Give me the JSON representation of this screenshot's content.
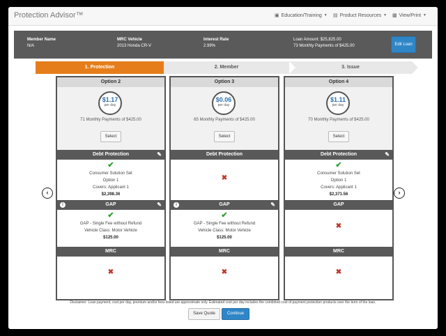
{
  "app": {
    "title": "Protection Advisor™"
  },
  "nav": {
    "education": {
      "icon": "briefcase-icon",
      "label": "Education/Training"
    },
    "resources": {
      "icon": "document-icon",
      "label": "Product Resources"
    },
    "view": {
      "icon": "printer-icon",
      "label": "View/Print"
    }
  },
  "loan": {
    "member_label": "Member Name",
    "member_value": "N/A",
    "vehicle_label": "MRC Vehicle",
    "vehicle_value": "2013 Honda CR-V",
    "rate_label": "Interest Rate",
    "rate_value": "2.99%",
    "amount_line": "Loan Amount: $25,825.00",
    "payments_line": "73 Monthly Payments of $425.00",
    "edit_label": "Edit Loan"
  },
  "steps": [
    "1. Protection",
    "2. Member",
    "3. Issue"
  ],
  "cards": [
    {
      "title": "Option 2",
      "price": "$1.17",
      "per_day": "per day",
      "payments": "71 Monthly Payments of $425.00",
      "select": "Select",
      "debt": {
        "header": "Debt Protection",
        "status": "check",
        "lines": [
          "Consumer Solution Set",
          "Option 1",
          "Covers: Applicant 1"
        ],
        "amount": "$2,398.36"
      },
      "gap": {
        "header": "GAP",
        "status": "check",
        "lines": [
          "GAP - Single Fee without Refund",
          "Vehicle Class: Motor Vehicle"
        ],
        "amount": "$125.00"
      },
      "mrc": {
        "header": "MRC",
        "status": "x"
      }
    },
    {
      "title": "Option 3",
      "price": "$0.06",
      "per_day": "per day",
      "payments": "65 Monthly Payments of $425.00",
      "select": "Select",
      "debt": {
        "header": "Debt Protection",
        "status": "x"
      },
      "gap": {
        "header": "GAP",
        "status": "check",
        "lines": [
          "GAP - Single Fee without Refund",
          "Vehicle Class: Motor Vehicle"
        ],
        "amount": "$125.00"
      },
      "mrc": {
        "header": "MRC",
        "status": "x"
      }
    },
    {
      "title": "Option 4",
      "price": "$1.11",
      "per_day": "per day",
      "payments": "70 Monthly Payments of $425.00",
      "select": "Select",
      "debt": {
        "header": "Debt Protection",
        "status": "check",
        "lines": [
          "Consumer Solution Set",
          "Option 1",
          "Covers: Applicant 1"
        ],
        "amount": "$2,371.56"
      },
      "gap": {
        "header": "GAP",
        "status": "x"
      },
      "mrc": {
        "header": "MRC",
        "status": "x"
      }
    }
  ],
  "disclaimer": "Disclaimer: Loan payment, cost per day, premium and/or fees listed are approximate only. Estimated cost per day includes the combined cost of payment protection products over the term of the loan.",
  "actions": {
    "save": "Save Quote",
    "continue": "Continue"
  },
  "colors": {
    "accent": "#e57e1a",
    "primary": "#2f86c7",
    "check": "#2e9e2e",
    "cross": "#c0392b"
  }
}
